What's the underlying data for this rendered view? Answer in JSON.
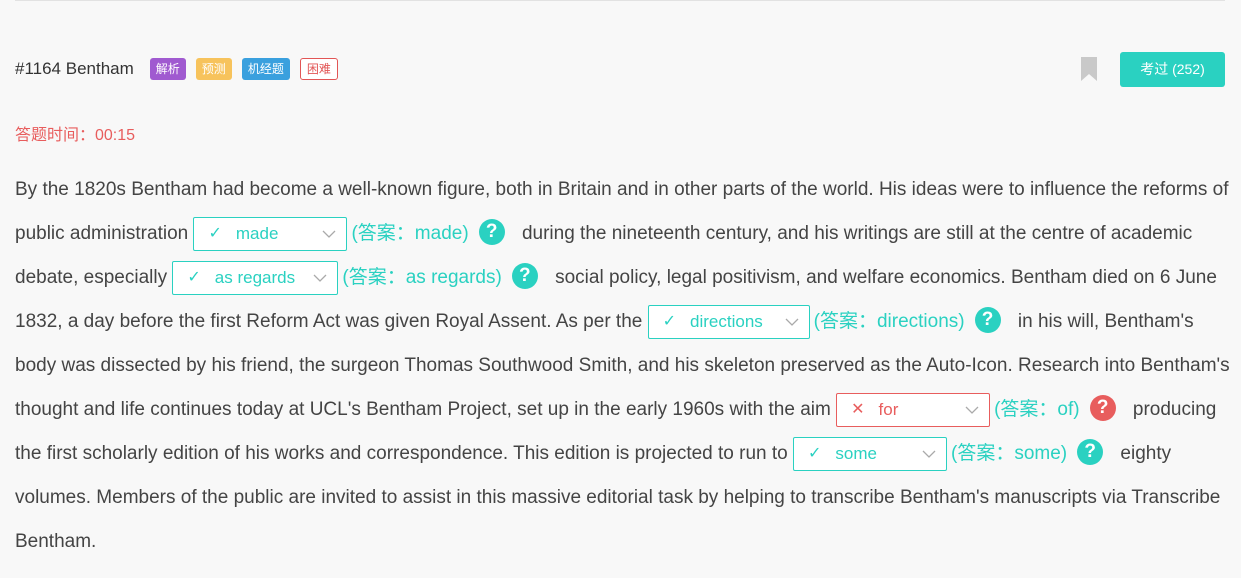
{
  "header": {
    "question_id": "#1164 Bentham",
    "badges": [
      "解析",
      "预测",
      "机经题",
      "困难"
    ],
    "done_button": "考过 (252)"
  },
  "timer": "答题时间：00:15",
  "passage": {
    "p1": "By the 1820s Bentham had become a well-known figure, both in Britain and in other parts of the world. His ideas were to influence the reforms of public administration",
    "p2": "during the nineteenth century, and his writings are still at the centre of academic debate, especially",
    "p3": "social policy, legal positivism, and welfare economics. Bentham died on 6 June 1832, a day before the first Reform Act was given Royal Assent. As per the",
    "p4": "in his will, Bentham's body was dissected by his friend, the surgeon Thomas Southwood Smith, and his skeleton preserved as the Auto-Icon. Research into Bentham's thought and life continues today at UCL's Bentham Project, set up in the early 1960s with the aim",
    "p5": "producing the first scholarly edition of his works and correspondence. This edition is projected to run to",
    "p6": "eighty volumes. Members of the public are invited to assist in this massive editorial task by helping to transcribe Bentham's manuscripts via Transcribe Bentham."
  },
  "blanks": [
    {
      "value": "made",
      "status": "correct",
      "answer": "(答案：made)"
    },
    {
      "value": "as regards",
      "status": "correct",
      "answer": "(答案：as regards)"
    },
    {
      "value": "directions",
      "status": "correct",
      "answer": "(答案：directions)"
    },
    {
      "value": "for",
      "status": "wrong",
      "answer": "(答案：of)"
    },
    {
      "value": "some",
      "status": "correct",
      "answer": "(答案：some)"
    }
  ],
  "marks": {
    "correct": "✓",
    "wrong": "✕",
    "help": "?"
  },
  "colors": {
    "accent": "#2ad1c1",
    "error": "#e85d5d",
    "purple": "#a05ad0",
    "yellow": "#f7c35c",
    "blue": "#3aa0de"
  }
}
